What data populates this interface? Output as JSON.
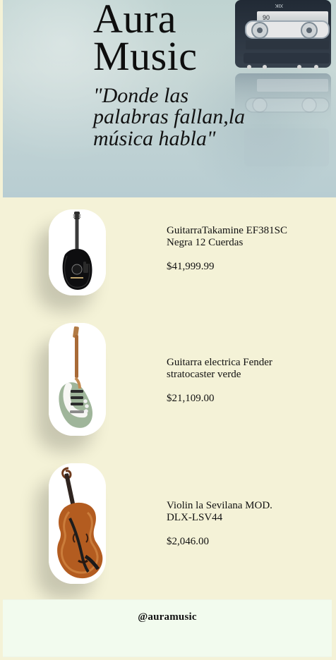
{
  "header": {
    "title": "Aura\nMusic",
    "tagline": "\"Donde las palabras fallan,la música habla\"",
    "tape_label_top": "90",
    "tape_label_bottom": "XIK"
  },
  "products": [
    {
      "name": "GuitarraTakamine EF381SC Negra 12 Cuerdas",
      "price": "$41,999.99",
      "image_icon": "acoustic-guitar-icon"
    },
    {
      "name": "Guitarra electrica Fender stratocaster verde",
      "price": "$21,109.00",
      "image_icon": "electric-guitar-icon"
    },
    {
      "name": "Violin la Sevilana MOD. DLX-LSV44",
      "price": "$2,046.00",
      "image_icon": "violin-icon"
    }
  ],
  "footer": {
    "handle": "@auramusic"
  },
  "theme": {
    "page_background": "#f4f2d7",
    "footer_background": "#f2fbee",
    "header_background": "#c4d5d4",
    "text_color": "#111111"
  }
}
